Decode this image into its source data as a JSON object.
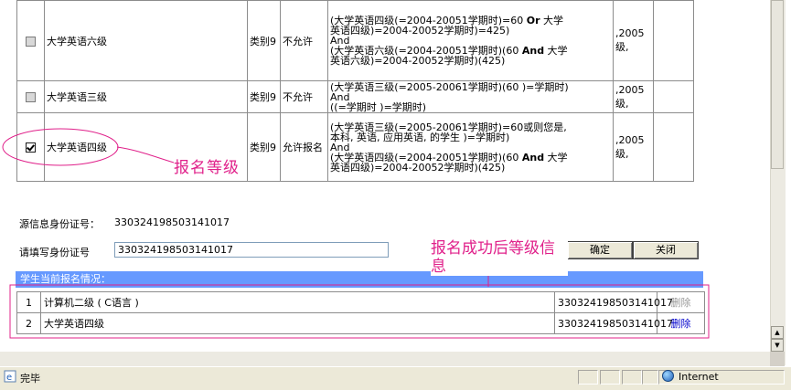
{
  "exam_rows": [
    {
      "checked": false,
      "name": "大学英语六级",
      "category": "类别9",
      "status": "不允许",
      "condition": [
        "(大学英语四级(=2004-20051学期时)=60 <b>Or</b> 大学",
        "英语四级)=2004-20052学期时)=425)",
        "And",
        "(大学英语六级(=2004-20051学期时)(60 <b>And</b> 大学",
        "英语六级)=2004-20052学期时)(425)"
      ],
      "year": ",2005",
      "year_suffix": "级,"
    },
    {
      "checked": false,
      "name": "大学英语三级",
      "category": "类别9",
      "status": "不允许",
      "condition": [
        "(大学英语三级(=2005-20061学期时)(60  )=学期时)",
        "And",
        "((=学期时  )=学期时)"
      ],
      "year": ",2005",
      "year_suffix": "级,"
    },
    {
      "checked": true,
      "name": "大学英语四级",
      "category": "类别9",
      "status": "允许报名",
      "condition": [
        "(大学英语三级(=2005-20061学期时)=60或则您是,",
        "本科, 英语, 应用英语, 的学生  )=学期时)",
        "And",
        "(大学英语四级(=2004-20051学期时)(60 <b>And</b> 大学",
        "英语四级)=2004-20052学期时)(425)"
      ],
      "year": ",2005",
      "year_suffix": "级,"
    }
  ],
  "form": {
    "source_id_label": "源信息身份证号：",
    "source_id_value": "330324198503141017",
    "fill_id_label": "请填写身份证号",
    "fill_id_value": "330324198503141017",
    "confirm_label": "确定",
    "close_label": "关闭"
  },
  "current": {
    "header": "学生当前报名情况：",
    "rows": [
      {
        "index": "1",
        "name": "计算机二级 ( C语言 )",
        "id": "330324198503141017",
        "action": "删除",
        "action_enabled": false
      },
      {
        "index": "2",
        "name": "大学英语四级",
        "id": "330324198503141017",
        "action": "删除",
        "action_enabled": true
      }
    ]
  },
  "annotations": {
    "level": "报名等级",
    "after_success": "报名成功后等级信息"
  },
  "statusbar": {
    "text": "完毕",
    "zone": "Internet"
  },
  "colors": {
    "annotation": "#e0208a",
    "section_header": "#6699ff",
    "link_enabled": "#0000cc",
    "link_disabled": "#999999"
  }
}
